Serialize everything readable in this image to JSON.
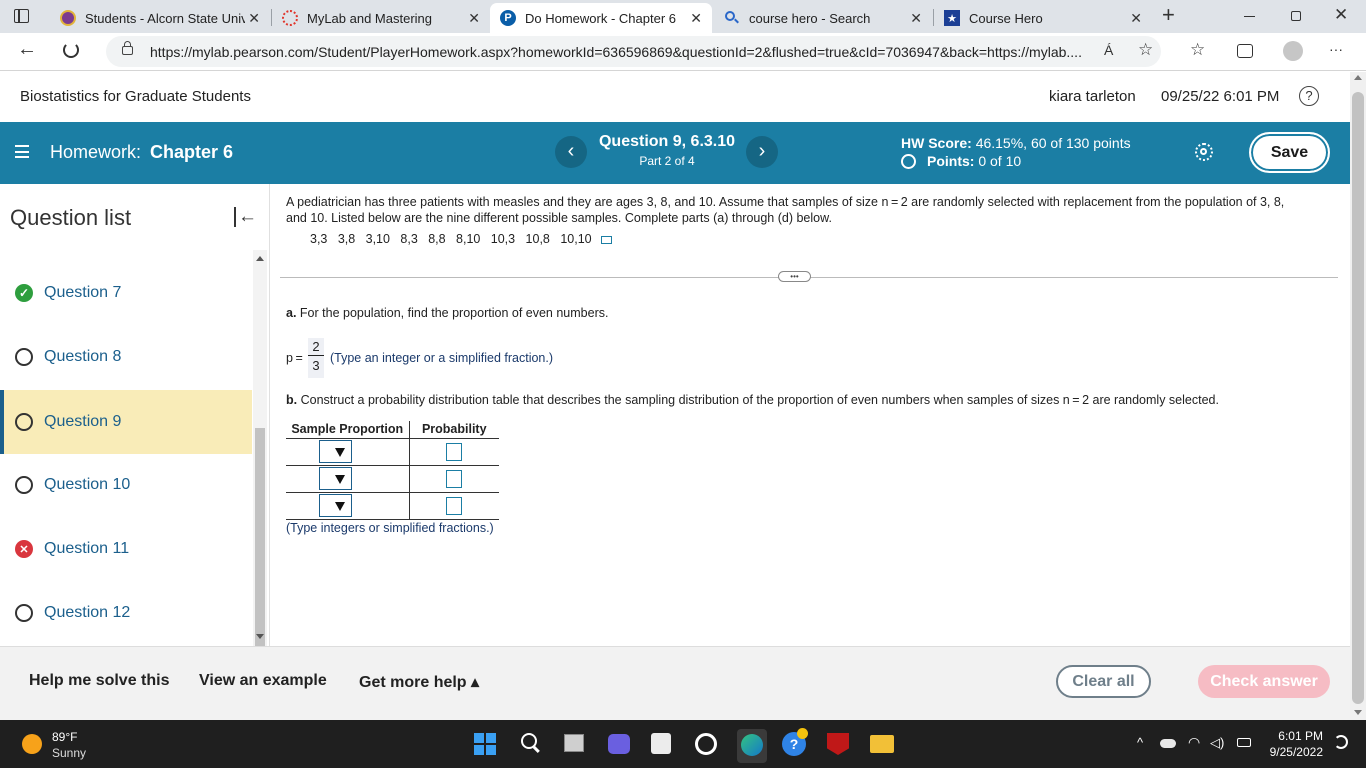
{
  "browser": {
    "tabs": [
      {
        "title": "Students - Alcorn State Unive",
        "close": "✕"
      },
      {
        "title": "MyLab and Mastering",
        "close": "✕"
      },
      {
        "title": "Do Homework - Chapter 6",
        "close": "✕"
      },
      {
        "title": "course hero - Search",
        "close": "✕"
      },
      {
        "title": "Course Hero",
        "close": "✕"
      }
    ],
    "new_tab": "+",
    "url": "https://mylab.pearson.com/Student/PlayerHomework.aspx?homeworkId=636596869&questionId=2&flushed=true&cId=7036947&back=https://mylab....",
    "read_aloud": "Á",
    "more": "···"
  },
  "app": {
    "course_title": "Biostatistics for Graduate Students",
    "user_name": "kiara tarleton",
    "datetime": "09/25/22 6:01 PM",
    "help": "?"
  },
  "hwbar": {
    "label": "Homework:",
    "chapter": "Chapter 6",
    "question_title": "Question 9, 6.3.10",
    "part": "Part 2 of 4",
    "prev": "‹",
    "next": "›",
    "score_label": "HW Score:",
    "score_value": "46.15%, 60 of 130 points",
    "points_label": "Points:",
    "points_value": "0 of 10",
    "save": "Save"
  },
  "sidebar": {
    "title": "Question list",
    "collapse": "|←",
    "items": [
      {
        "label": "Question 7",
        "status": "correct"
      },
      {
        "label": "Question 8",
        "status": "open"
      },
      {
        "label": "Question 9",
        "status": "current"
      },
      {
        "label": "Question 10",
        "status": "open"
      },
      {
        "label": "Question 11",
        "status": "incorrect"
      },
      {
        "label": "Question 12",
        "status": "open"
      }
    ]
  },
  "question": {
    "text_line1": "A pediatrician has three patients with measles and they are ages 3, 8, and 10. Assume that samples of size n = 2 are randomly selected with replacement from the population of 3, 8,",
    "text_line2": "and 10. Listed below are the nine different possible samples. Complete parts (a) through (d) below.",
    "samples": [
      "3,3",
      "3,8",
      "3,10",
      "8,3",
      "8,8",
      "8,10",
      "10,3",
      "10,8",
      "10,10"
    ],
    "divider_label": "•••",
    "part_a_letter": "a.",
    "part_a": "For the population, find the proportion of even numbers.",
    "p_label": "p =",
    "p_num": "2",
    "p_den": "3",
    "p_hint": "(Type an integer or a simplified fraction.)",
    "part_b_letter": "b.",
    "part_b": "Construct a probability distribution table that describes the sampling distribution of the proportion of even numbers when samples of sizes n = 2 are randomly selected.",
    "table_headers": [
      "Sample Proportion",
      "Probability"
    ],
    "table_hint": "(Type integers or simplified fractions.)"
  },
  "actions": {
    "help_solve": "Help me solve this",
    "view_example": "View an example",
    "more_help": "Get more help ▴",
    "clear_all": "Clear all",
    "check_answer": "Check answer"
  },
  "taskbar": {
    "temp": "89°F",
    "weather": "Sunny",
    "time": "6:01 PM",
    "date": "9/25/2022",
    "tray_up": "^"
  },
  "colors": {
    "hw_bar": "#1b7ea4",
    "link": "#1b5f8c",
    "current_question_bg": "#f9ecb8",
    "check_answer_bg": "#f6bcc4",
    "correct": "#2e9e3e",
    "incorrect": "#d9363e"
  }
}
